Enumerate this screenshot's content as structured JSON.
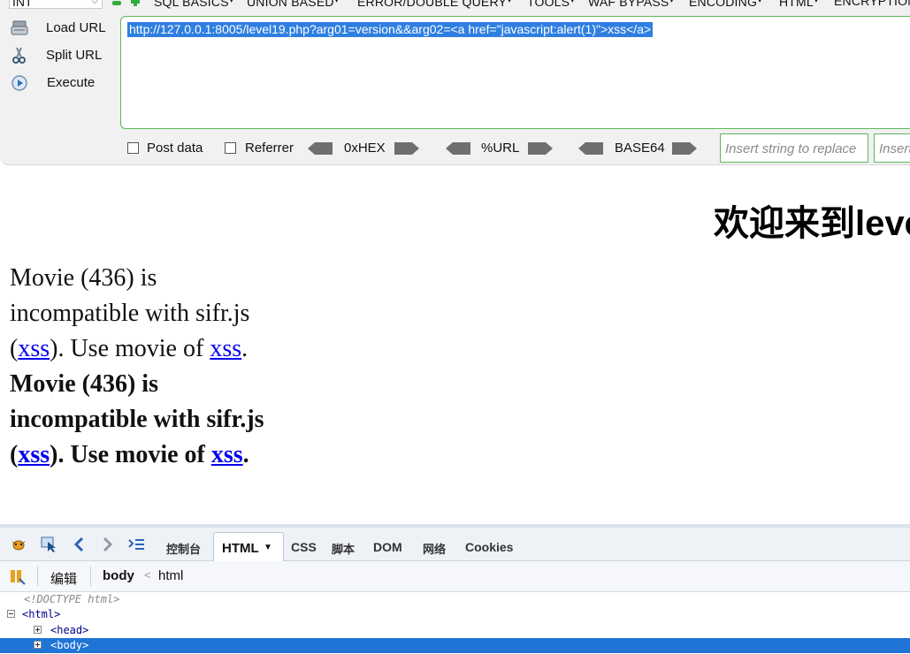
{
  "hackbar": {
    "type_select": "INT",
    "menus": [
      "SQL BASICS",
      "UNION BASED",
      "ERROR/DOUBLE QUERY",
      "TOOLS",
      "WAF BYPASS",
      "ENCODING",
      "HTML",
      "ENCRYPTION"
    ],
    "actions": {
      "load_url": "Load URL",
      "split_url": "Split URL",
      "execute": "Execute"
    },
    "url": "http://127.0.0.1:8005/level19.php?arg01=version&&arg02=<a href=\"javascript:alert(1)\">xss</a>",
    "options": {
      "post_data": "Post data",
      "referrer": "Referrer",
      "hex": "0xHEX",
      "url_enc": "%URL",
      "base64": "BASE64"
    },
    "replace_placeholder": "Insert string to replace",
    "replace_with_placeholder": "Insert"
  },
  "page": {
    "heading": "欢迎来到leve",
    "movie": {
      "line1": "Movie (436) is",
      "line2": "incompatible with sifr.js",
      "paren_open": "(",
      "link": "xss",
      "mid_text": "). Use movie of ",
      "end": ".",
      "cut_line": "Movie (436) is incompatible"
    }
  },
  "firebug": {
    "tabs": {
      "console": "控制台",
      "html": "HTML",
      "css": "CSS",
      "script": "脚本",
      "dom": "DOM",
      "net": "网络",
      "cookies": "Cookies"
    },
    "toolbar": {
      "edit": "编辑",
      "crumb_body": "body",
      "crumb_sep": "<",
      "crumb_html": "html"
    },
    "tree": {
      "doctype": "<!DOCTYPE html>",
      "html": "<html>",
      "head": "<head>",
      "body": "<body>"
    }
  },
  "colors": {
    "url_highlight": "#2f7fe0",
    "link": "#0000ee",
    "hackbar_border": "#5cb85c",
    "tree_selected": "#1f74d6"
  }
}
